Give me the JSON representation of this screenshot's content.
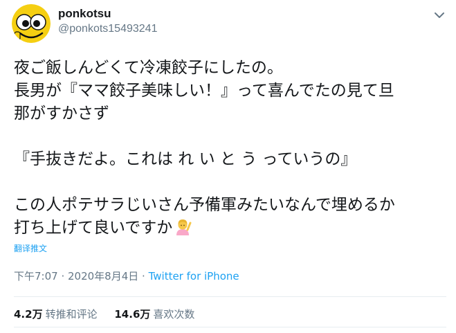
{
  "author": {
    "display_name": "ponkotsu",
    "handle": "@ponkots15493241"
  },
  "tweet": {
    "lines": [
      "夜ご飯しんどくて冷凍餃子にしたの。",
      "長男が『ママ餃子美味しい！』って喜んでたの見て旦",
      "那がすかさず",
      "",
      "『手抜きだよ。これは れ い と う っていうの』",
      "",
      "この人ポテサラじいさん予備軍みたいなんで埋めるか",
      "打ち上げて良いですか"
    ],
    "translate_label": "翻译推文"
  },
  "meta": {
    "time": "下午7:07",
    "separator1": " · ",
    "date": "2020年8月4日",
    "separator2": " · ",
    "source": "Twitter for iPhone"
  },
  "stats": {
    "retweets_count": "4.2万",
    "retweets_label": "转推和评论",
    "likes_count": "14.6万",
    "likes_label": "喜欢次数"
  },
  "icons": {
    "avatar": "smiley-face-avatar",
    "caret": "chevron-down-icon",
    "emoji": "person-raising-hand-emoji"
  },
  "colors": {
    "text": "#14171a",
    "secondary": "#657786",
    "link": "#1da1f2",
    "divider": "#e6ecf0"
  }
}
